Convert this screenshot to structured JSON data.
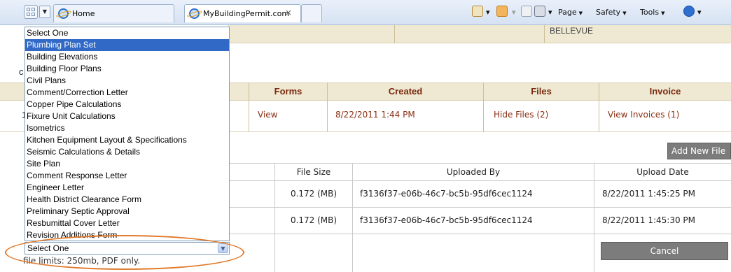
{
  "browser": {
    "tabs": [
      {
        "label": "Home"
      },
      {
        "label": "MyBuildingPermit.com",
        "close": "×"
      }
    ],
    "commands": {
      "page": "Page",
      "safety": "Safety",
      "tools": "Tools"
    }
  },
  "header": {
    "city": "BELLEVUE"
  },
  "invoice_table": {
    "headers": [
      "Forms",
      "Created",
      "Files",
      "Invoice"
    ],
    "row": {
      "forms": "View",
      "created": "8/22/2011 1:44 PM",
      "files": "Hide Files (2)",
      "invoice": "View Invoices (1)"
    }
  },
  "files": {
    "add_button": "Add New File",
    "headers": [
      "File Size",
      "Uploaded By",
      "Upload Date"
    ],
    "rows": [
      {
        "size": "0.172 (MB)",
        "uploaded_by": "f3136f37-e06b-46c7-bc5b-95df6cec1124",
        "date": "8/22/2011 1:45:25 PM"
      },
      {
        "size": "0.172 (MB)",
        "uploaded_by": "f3136f37-e06b-46c7-bc5b-95df6cec1124",
        "date": "8/22/2011 1:45:30 PM"
      }
    ],
    "cancel_button": "Cancel"
  },
  "fragments": {
    "left_c": "c",
    "left_1": "1"
  },
  "document_type_dropdown": {
    "options": [
      "Select One",
      "Plumbing Plan Set",
      "Building Elevations",
      "Building Floor Plans",
      "Civil Plans",
      "Comment/Correction Letter",
      "Copper Pipe Calculations",
      "Fixure Unit Calculations",
      "Isometrics",
      "Kitchen Equipment Layout & Specifications",
      "Seismic Calculations & Details",
      "Site Plan",
      "Comment Response Letter",
      "Engineer Letter",
      "Health District Clearance Form",
      "Preliminary Septic Approval",
      "Resbumittal Cover Letter",
      "Revision Additions Form"
    ],
    "highlighted_index": 1,
    "selected_value": "Select One",
    "annotation_color": "#e07a2c"
  },
  "file_limits": "file limits: 250mb, PDF only."
}
